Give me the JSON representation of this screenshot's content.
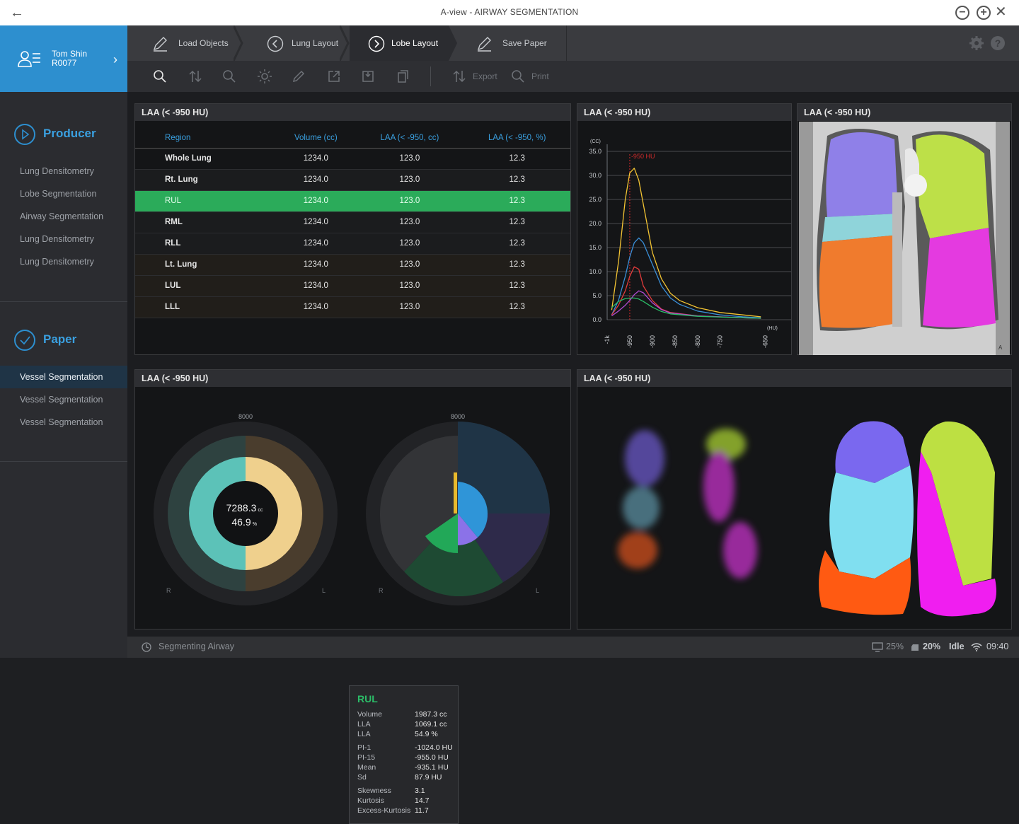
{
  "window": {
    "title": "A-view - AIRWAY SEGMENTATION"
  },
  "user": {
    "name": "Tom Shin",
    "id": "R0077"
  },
  "sidebar": {
    "producer": {
      "label": "Producer",
      "items": [
        "Lung Densitometry",
        "Lobe Segmentation",
        "Airway Segmentation",
        "Lung Densitometry",
        "Lung Densitometry"
      ]
    },
    "paper": {
      "label": "Paper",
      "items": [
        "Vessel Segmentation",
        "Vessel Segmentation",
        "Vessel Segmentation"
      ],
      "active_index": 0
    }
  },
  "steps": [
    {
      "label": "Load Objects",
      "icon": "pen-icon"
    },
    {
      "label": "Lung Layout",
      "icon": "chevron-left-circle-icon"
    },
    {
      "label": "Lobe Layout",
      "icon": "chevron-right-circle-icon",
      "active": true
    },
    {
      "label": "Save Paper",
      "icon": "pen-icon"
    }
  ],
  "toolbar": {
    "export_label": "Export",
    "print_label": "Print"
  },
  "table_panel": {
    "title": "LAA (< -950 HU)",
    "columns": [
      "Region",
      "Volume (cc)",
      "LAA (< -950, cc)",
      "LAA (< -950, %)"
    ],
    "rows": [
      [
        "Whole Lung",
        "1234.0",
        "123.0",
        "12.3"
      ],
      [
        "Rt. Lung",
        "1234.0",
        "123.0",
        "12.3"
      ],
      [
        "RUL",
        "1234.0",
        "123.0",
        "12.3"
      ],
      [
        "RML",
        "1234.0",
        "123.0",
        "12.3"
      ],
      [
        "RLL",
        "1234.0",
        "123.0",
        "12.3"
      ],
      [
        "Lt. Lung",
        "1234.0",
        "123.0",
        "12.3"
      ],
      [
        "LUL",
        "1234.0",
        "123.0",
        "12.3"
      ],
      [
        "LLL",
        "1234.0",
        "123.0",
        "12.3"
      ]
    ],
    "selected_row": 2
  },
  "histogram_panel": {
    "title": "LAA (< -950 HU)",
    "marker_label": "-950 HU",
    "y_unit": "(CC)",
    "x_unit": "(HU)"
  },
  "ct_panel": {
    "title": "LAA (< -950 HU)",
    "corner_label": "A"
  },
  "donut_panel": {
    "title": "LAA (< -950 HU)",
    "center_volume": "7288.3",
    "center_volume_unit": "cc",
    "center_percent": "46.9",
    "center_percent_unit": "%",
    "scale_top_left": "8000",
    "scale_top_right": "8000",
    "left_r": "R",
    "left_l": "L",
    "right_r": "R",
    "right_l": "L"
  },
  "tooltip": {
    "title": "RUL",
    "rows": [
      [
        "Volume",
        "1987.3 cc"
      ],
      [
        "LLA",
        "1069.1 cc"
      ],
      [
        "LLA",
        "54.9 %"
      ],
      [
        "PI-1",
        "-1024.0 HU"
      ],
      [
        "PI-15",
        "-955.0 HU"
      ],
      [
        "Mean",
        "-935.1 HU"
      ],
      [
        "Sd",
        "87.9 HU"
      ],
      [
        "Skewness",
        "3.1"
      ],
      [
        "Kurtosis",
        "14.7"
      ],
      [
        "Excess-Kurtosis",
        "11.7"
      ]
    ]
  },
  "render_panel": {
    "title": "LAA (< -950 HU)"
  },
  "status": {
    "task": "Segmenting Airway",
    "cpu": "25%",
    "battery": "20%",
    "state": "Idle",
    "time": "09:40"
  },
  "colors": {
    "accent": "#2d8fcf",
    "selected": "#2bab5a",
    "rul": "#2bbd68"
  },
  "chart_data": {
    "type": "line",
    "ylabel": "(CC)",
    "xlabel": "(HU)",
    "ylim": [
      0,
      35
    ],
    "xlim": [
      -1000,
      -640
    ],
    "yticks": [
      "0.0",
      "5.0",
      "10.0",
      "15.0",
      "20.0",
      "25.0",
      "30.0",
      "35.0"
    ],
    "xticks": [
      "-1k",
      "-950",
      "-900",
      "-850",
      "-800",
      "-750",
      "-650"
    ],
    "reference_line": -950,
    "series": [
      {
        "color": "#f3c433",
        "x": [
          -990,
          -975,
          -960,
          -950,
          -940,
          -930,
          -920,
          -900,
          -880,
          -860,
          -840,
          -800,
          -750,
          -700,
          -660
        ],
        "y": [
          2,
          12,
          25,
          30.5,
          31.5,
          29,
          24,
          14,
          8.5,
          5.5,
          4,
          2.5,
          1.5,
          1,
          0.6
        ]
      },
      {
        "color": "#3a8fd8",
        "x": [
          -990,
          -975,
          -960,
          -950,
          -940,
          -930,
          -920,
          -900,
          -880,
          -860,
          -840,
          -800,
          -750,
          -700,
          -660
        ],
        "y": [
          1,
          4,
          9,
          13,
          16,
          17,
          16,
          11.5,
          7,
          4.5,
          3.2,
          1.8,
          1,
          0.6,
          0.4
        ]
      },
      {
        "color": "#e23b3b",
        "x": [
          -990,
          -975,
          -960,
          -950,
          -940,
          -930,
          -920,
          -900,
          -880,
          -860,
          -800,
          -700,
          -660
        ],
        "y": [
          1,
          3,
          6,
          9,
          11,
          10.5,
          7,
          4,
          2.2,
          1.5,
          0.8,
          0.4,
          0.3
        ]
      },
      {
        "color": "#b04ad0",
        "x": [
          -990,
          -975,
          -960,
          -950,
          -940,
          -930,
          -920,
          -900,
          -880,
          -860,
          -800,
          -700,
          -660
        ],
        "y": [
          0.8,
          1.8,
          3,
          4,
          5.2,
          6,
          5.6,
          3.5,
          2.1,
          1.4,
          0.8,
          0.4,
          0.3
        ]
      },
      {
        "color": "#2bbd68",
        "x": [
          -990,
          -975,
          -960,
          -950,
          -940,
          -930,
          -920,
          -900,
          -880,
          -860,
          -800,
          -700,
          -660
        ],
        "y": [
          2.5,
          3.8,
          4.4,
          4.5,
          4.5,
          4.3,
          3.8,
          2.6,
          1.7,
          1.2,
          0.7,
          0.4,
          0.3
        ]
      }
    ]
  }
}
